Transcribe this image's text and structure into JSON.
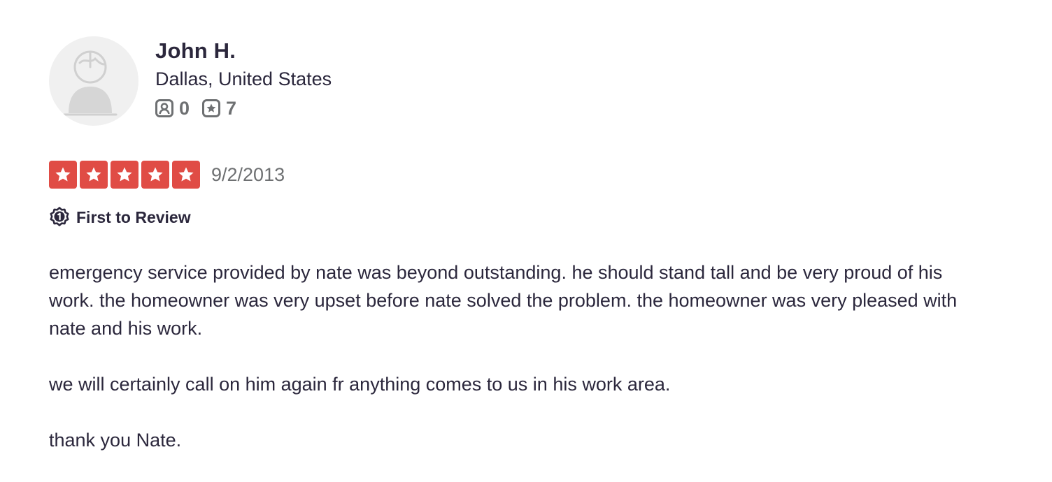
{
  "user": {
    "name": "John H.",
    "location": "Dallas, United States",
    "avatar_icon": "default-user-avatar",
    "friends_icon": "friends-icon",
    "friends_count": "0",
    "reviews_icon": "reviews-icon",
    "reviews_count": "7"
  },
  "review": {
    "rating": 5,
    "rating_max": 5,
    "star_color": "#e04c45",
    "date": "9/2/2013",
    "badge": {
      "icon": "first-review-badge-icon",
      "label": "First to Review"
    },
    "paragraphs": [
      "emergency service provided by nate was beyond outstanding. he should stand tall and be very proud of his work. the homeowner was very upset before nate solved the problem. the homeowner was very pleased with nate and his work.",
      "we will certainly call on him again fr anything comes to us in his work area.",
      "thank you Nate."
    ]
  }
}
